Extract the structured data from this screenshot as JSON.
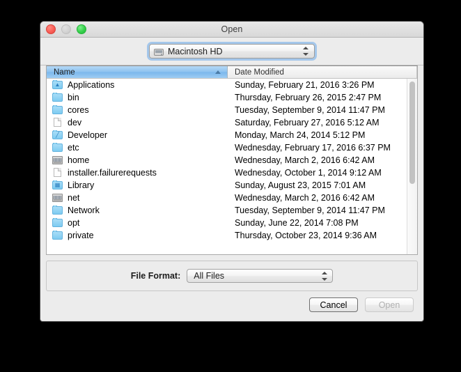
{
  "window": {
    "title": "Open",
    "traffic_lights": [
      {
        "name": "close",
        "color": "#fa5e57"
      },
      {
        "name": "minimize",
        "color": "#d2d2d2"
      },
      {
        "name": "zoom",
        "color": "#35cf4b"
      }
    ]
  },
  "volume_chooser": {
    "icon": "hard-drive-icon",
    "value": "Macintosh HD"
  },
  "browser": {
    "columns": [
      {
        "key": "name",
        "label": "Name",
        "sorted": true,
        "sort_direction": "ascending"
      },
      {
        "key": "date_modified",
        "label": "Date Modified",
        "sorted": false
      }
    ],
    "rows": [
      {
        "icon": "folder-applications-icon",
        "name": "Applications",
        "date_modified": "Sunday, February 21, 2016 3:26 PM"
      },
      {
        "icon": "folder-icon",
        "name": "bin",
        "date_modified": "Thursday, February 26, 2015 2:47 PM"
      },
      {
        "icon": "folder-icon",
        "name": "cores",
        "date_modified": "Tuesday, September 9, 2014 11:47 PM"
      },
      {
        "icon": "document-icon",
        "name": "dev",
        "date_modified": "Saturday, February 27, 2016 5:12 AM"
      },
      {
        "icon": "folder-developer-icon",
        "name": "Developer",
        "date_modified": "Monday, March 24, 2014 5:12 PM"
      },
      {
        "icon": "folder-icon",
        "name": "etc",
        "date_modified": "Wednesday, February 17, 2016 6:37 PM"
      },
      {
        "icon": "server-icon",
        "name": "home",
        "date_modified": "Wednesday, March 2, 2016 6:42 AM"
      },
      {
        "icon": "document-icon",
        "name": "installer.failurerequests",
        "date_modified": "Wednesday, October 1, 2014 9:12 AM"
      },
      {
        "icon": "folder-library-icon",
        "name": "Library",
        "date_modified": "Sunday, August 23, 2015 7:01 AM"
      },
      {
        "icon": "server-icon",
        "name": "net",
        "date_modified": "Wednesday, March 2, 2016 6:42 AM"
      },
      {
        "icon": "folder-icon",
        "name": "Network",
        "date_modified": "Tuesday, September 9, 2014 11:47 PM"
      },
      {
        "icon": "folder-icon",
        "name": "opt",
        "date_modified": "Sunday, June 22, 2014 7:08 PM"
      },
      {
        "icon": "folder-icon",
        "name": "private",
        "date_modified": "Thursday, October 23, 2014 9:36 AM"
      }
    ]
  },
  "accessory": {
    "file_format_label": "File Format:",
    "file_format_value": "All Files"
  },
  "buttons": {
    "cancel": {
      "label": "Cancel",
      "enabled": true
    },
    "open": {
      "label": "Open",
      "enabled": false
    }
  }
}
